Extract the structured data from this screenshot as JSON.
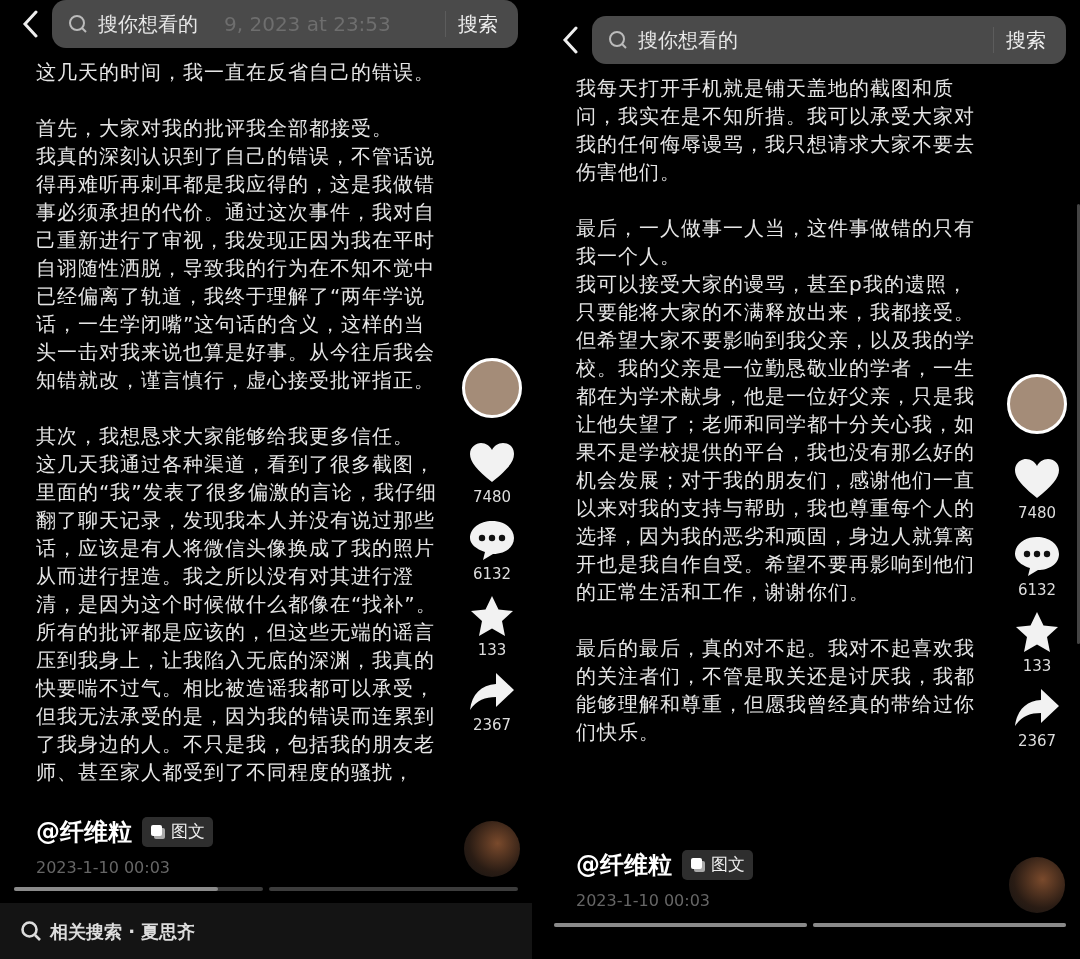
{
  "panels": [
    {
      "search": {
        "placeholder": "搜你想看的",
        "button": "搜索",
        "background_text": "9, 2023 at 23:53"
      },
      "sections": [
        {
          "paragraphs": [
            "这几天的时间，我一直在反省自己的错误。"
          ]
        },
        {
          "paragraphs": [
            "首先，大家对我的批评我全部都接受。",
            "我真的深刻认识到了自己的错误，不管话说得再难听再刺耳都是我应得的，这是我做错事必须承担的代价。通过这次事件，我对自己重新进行了审视，我发现正因为我在平时自诩随性洒脱，导致我的行为在不知不觉中已经偏离了轨道，我终于理解了“两年学说话，一生学闭嘴”这句话的含义，这样的当头一击对我来说也算是好事。从今往后我会知错就改，谨言慎行，虚心接受批评指正。"
          ]
        },
        {
          "paragraphs": [
            "其次，我想恳求大家能够给我更多信任。",
            "这几天我通过各种渠道，看到了很多截图，里面的“我”发表了很多偏激的言论，我仔细翻了聊天记录，发现我本人并没有说过那些话，应该是有人将微信头像换成了我的照片从而进行捏造。我之所以没有对其进行澄清，是因为这个时候做什么都像在“找补”。所有的批评都是应该的，但这些无端的谣言压到我身上，让我陷入无底的深渊，我真的快要喘不过气。相比被造谣我都可以承受，但我无法承受的是，因为我的错误而连累到了我身边的人。不只是我，包括我的朋友老师、甚至家人都受到了不同程度的骚扰，"
          ]
        }
      ],
      "actions": [
        {
          "kind": "like",
          "count": "7480"
        },
        {
          "kind": "comment",
          "count": "6132"
        },
        {
          "kind": "favorite",
          "count": "133"
        },
        {
          "kind": "share",
          "count": "2367"
        }
      ],
      "author": "@纤维粒",
      "badge": "图文",
      "date": "2023-1-10 00:03",
      "progress": [
        {
          "level": 0.82
        },
        {
          "level": 0
        }
      ],
      "related_search": "相关搜索 · 夏思齐"
    },
    {
      "search": {
        "placeholder": "搜你想看的",
        "button": "搜索"
      },
      "sections": [
        {
          "paragraphs": [
            "我每天打开手机就是铺天盖地的截图和质问，我实在是不知所措。我可以承受大家对我的任何侮辱谩骂，我只想请求大家不要去伤害他们。"
          ]
        },
        {
          "paragraphs": [
            "最后，一人做事一人当，这件事做错的只有我一个人。",
            "我可以接受大家的谩骂，甚至p我的遗照，只要能将大家的不满释放出来，我都接受。但希望大家不要影响到我父亲，以及我的学校。我的父亲是一位勤恳敬业的学者，一生都在为学术献身，他是一位好父亲，只是我让他失望了；老师和同学都十分关心我，如果不是学校提供的平台，我也没有那么好的机会发展；对于我的朋友们，感谢他们一直以来对我的支持与帮助，我也尊重每个人的选择，因为我的恶劣和顽固，身边人就算离开也是我自作自受。希望不要再影响到他们的正常生活和工作，谢谢你们。"
          ]
        },
        {
          "paragraphs": [
            "最后的最后，真的对不起。我对不起喜欢我的关注者们，不管是取关还是讨厌我，我都能够理解和尊重，但愿我曾经真的带给过你们快乐。"
          ]
        }
      ],
      "actions": [
        {
          "kind": "like",
          "count": "7480"
        },
        {
          "kind": "comment",
          "count": "6132"
        },
        {
          "kind": "favorite",
          "count": "133"
        },
        {
          "kind": "share",
          "count": "2367"
        }
      ],
      "author": "@纤维粒",
      "badge": "图文",
      "date": "2023-1-10 00:03",
      "progress": [
        {
          "level": 1
        },
        {
          "level": 1
        }
      ]
    }
  ]
}
